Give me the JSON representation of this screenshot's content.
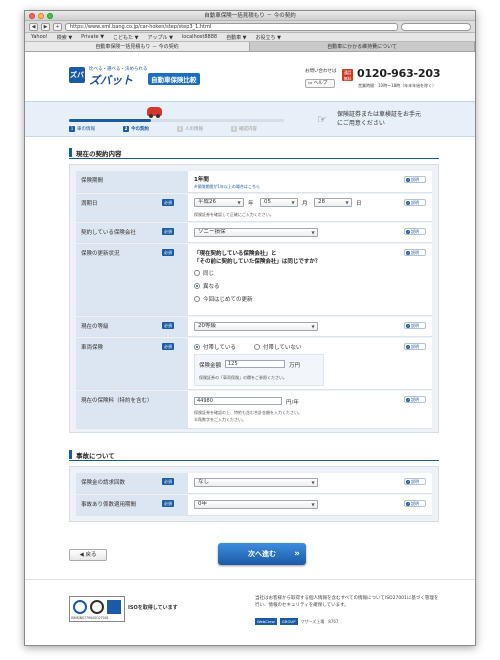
{
  "browser": {
    "title": "自動車保険一括見積もり － 今の契約",
    "url": "https://www.xml.bang.co.jp/car-hoken/step/step3_1.html",
    "nav_back": "◀",
    "nav_forward": "▶",
    "add": "+",
    "bookmarks": [
      "Yahoo!",
      "検索 ▼",
      "Private ▼",
      "こどもた ▼",
      "アップル ▼",
      "localhost8888",
      "自動車 ▼",
      "お役立ち ▼"
    ],
    "tabs": [
      "自動車保険一括見積もり － 今の契約",
      "自動車にかかる維持費について"
    ]
  },
  "header": {
    "logo_mark": "ズバ",
    "logo_tagline": "比べる・選べる・決められる",
    "logo_main": "ズバット",
    "logo_sub": "自動車保険比較",
    "inquiry_label": "お問い合わせは",
    "help_label": "ヘルプ",
    "phone_badge": "通話無料",
    "phone": "0120-963-203",
    "hours": "営業時間：10時～18時（年末年始を除く）"
  },
  "steps": {
    "progress": 0.38,
    "items": [
      {
        "num": "1",
        "label": "車の情報"
      },
      {
        "num": "2",
        "label": "今の契約"
      },
      {
        "num": "3",
        "label": "人の情報"
      },
      {
        "num": "4",
        "label": "確認内容"
      }
    ],
    "notice_line1": "保険証券または車検証をお手元",
    "notice_line2": "にご用意ください"
  },
  "section1": {
    "title": "現在の契約内容"
  },
  "section2": {
    "title": "事故について"
  },
  "labels": {
    "required": "必須",
    "explain": "説明"
  },
  "form": {
    "period": {
      "label": "保険期間",
      "value": "1年間",
      "note": "※保険期間が1年以上の場合はこちら"
    },
    "expiry": {
      "label": "満期日",
      "era_year": "平成26",
      "year_unit": "年",
      "month": "05",
      "month_unit": "月",
      "day": "28",
      "day_unit": "日",
      "note": "保険証券を確認して正確にご入力ください。"
    },
    "company": {
      "label": "契約している保険会社",
      "value": "ソニー損保"
    },
    "renewal": {
      "label": "保険の更新状況",
      "question_line1": "「現在契約している保険会社」と",
      "question_line2": "「その前に契約していた保険会社」は同じですか？",
      "options": [
        "同じ",
        "異なる",
        "今回はじめての更新"
      ],
      "selected": "異なる"
    },
    "grade": {
      "label": "現在の等級",
      "value": "20等級"
    },
    "vehicle_ins": {
      "label": "車両保険",
      "options": [
        "付帯している",
        "付帯していない"
      ],
      "amount_label": "保険金額",
      "amount_value": "125",
      "amount_unit": "万円",
      "note": "保険証券の「車両保険」の欄をご参照ください。"
    },
    "premium": {
      "label": "現在の保険料（特約を含む）",
      "value": "44980",
      "unit": "円/年",
      "note1": "保険証券を確認の上、特約も含む合計金額を入力ください。",
      "note2": "半角数字をご入力ください。"
    },
    "claims": {
      "label": "保険金の請求回数",
      "value": "なし"
    },
    "accident_period": {
      "label": "事故あり係数適用期間",
      "value": "0年"
    }
  },
  "buttons": {
    "back": "◀ 戻る",
    "next": "次へ進む"
  },
  "footer": {
    "iso_caption": "ISMS/BS7799/ISO27001",
    "iso_text": "ISOを取得しています",
    "privacy": "当社はお客様から取得する個人情報を含むすべての情報についてISO27001に基づく管理を行い、情報のセキュリティを確保しています。",
    "webcrew": "WebCrew",
    "group": "GROUP",
    "permit": "マザーズ上場　8767"
  },
  "colors": {
    "brand": "#1b5aa5",
    "band": "#e7f0f8",
    "accent_red": "#d33a1f"
  }
}
